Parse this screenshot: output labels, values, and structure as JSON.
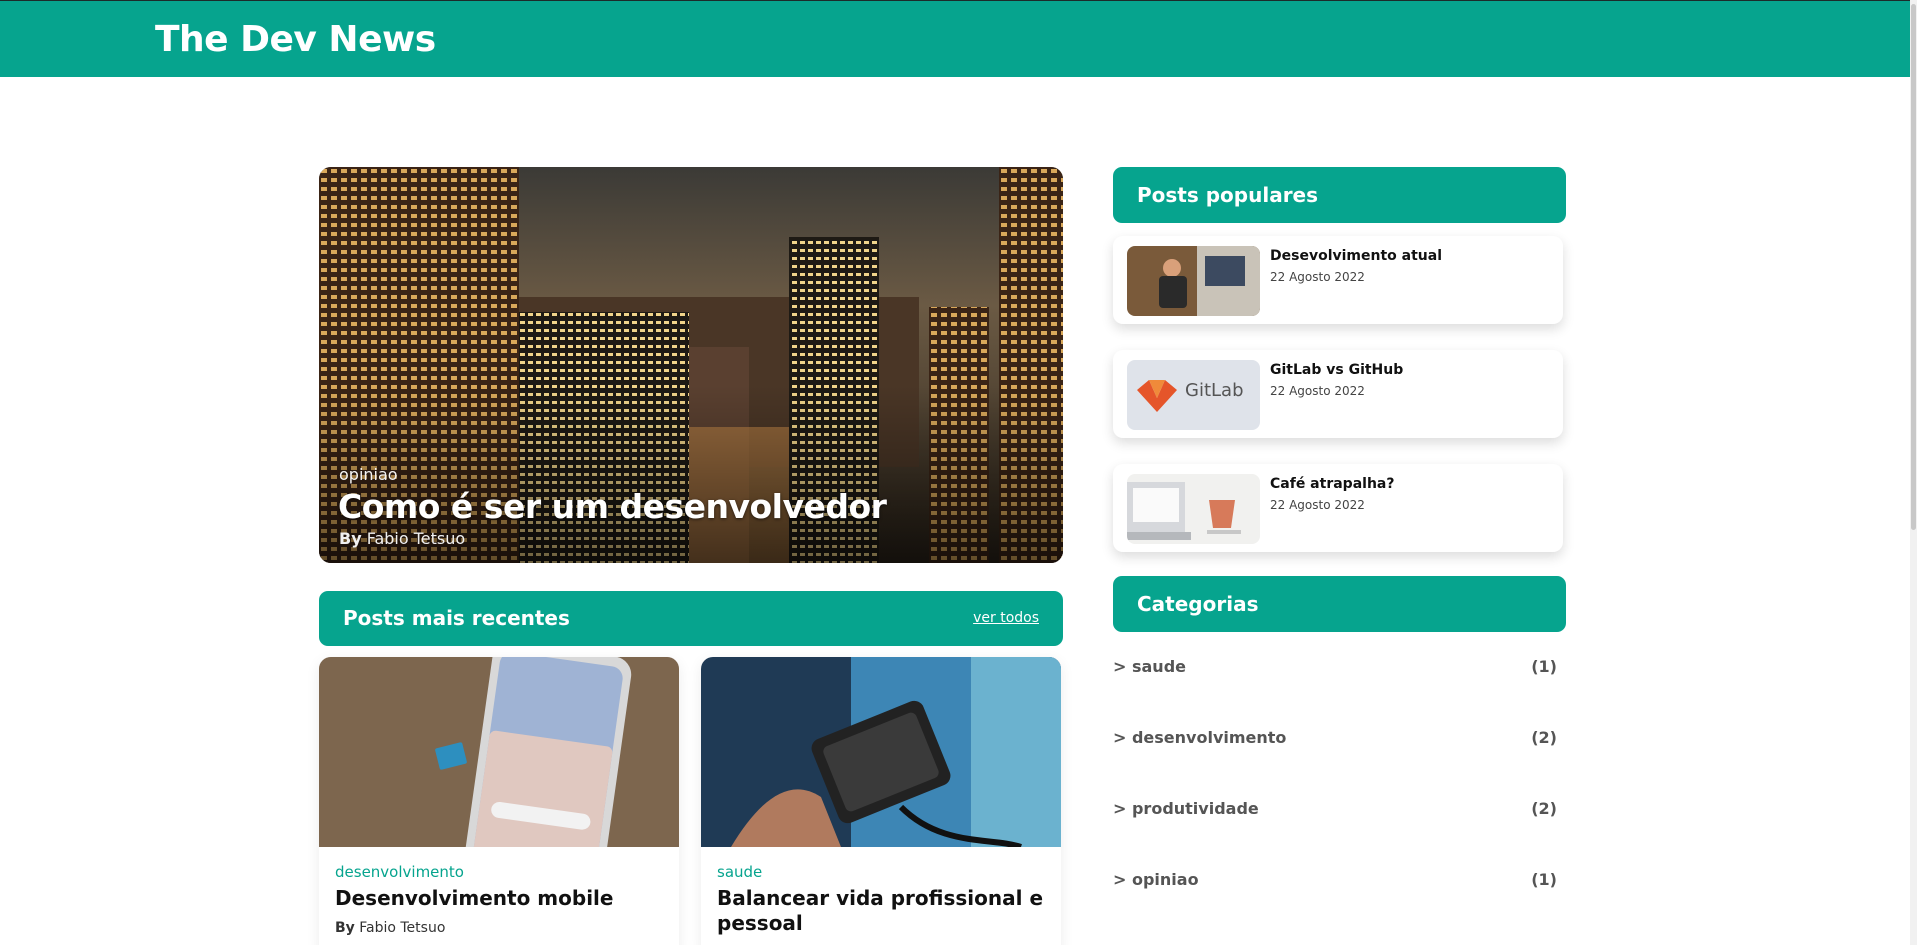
{
  "site": {
    "title": "The Dev News"
  },
  "hero": {
    "category": "opiniao",
    "title": "Como é ser um desenvolvedor",
    "author_prefix": "By",
    "author": "Fabio Tetsuo"
  },
  "recent": {
    "heading": "Posts mais recentes",
    "see_all": "ver todos",
    "posts": [
      {
        "category": "desenvolvimento",
        "title": "Desenvolvimento mobile",
        "author_prefix": "By",
        "author": "Fabio Tetsuo"
      },
      {
        "category": "saude",
        "title": "Balancear vida profissional e pessoal"
      }
    ]
  },
  "popular": {
    "heading": "Posts populares",
    "posts": [
      {
        "title": "Desevolvimento atual",
        "date": "22 Agosto 2022"
      },
      {
        "title": "GitLab vs GitHub",
        "date": "22 Agosto 2022",
        "thumb_text": "GitLab"
      },
      {
        "title": "Café atrapalha?",
        "date": "22 Agosto 2022"
      }
    ]
  },
  "categories": {
    "heading": "Categorias",
    "items": [
      {
        "name": "> saude",
        "count": "(1)"
      },
      {
        "name": "> desenvolvimento",
        "count": "(2)"
      },
      {
        "name": "> produtividade",
        "count": "(2)"
      },
      {
        "name": "> opiniao",
        "count": "(1)"
      }
    ]
  },
  "colors": {
    "brand": "#06a48e"
  }
}
